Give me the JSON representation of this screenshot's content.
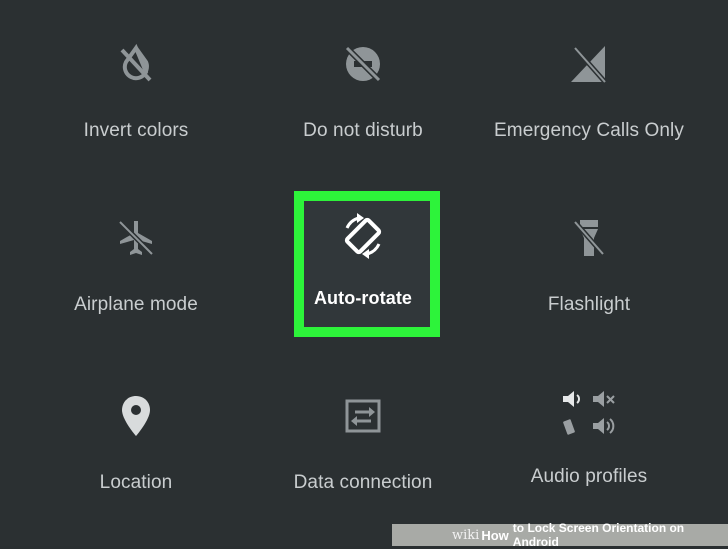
{
  "tiles": [
    {
      "label": "Invert colors",
      "icon": "invert-colors-off-icon"
    },
    {
      "label": "Do not disturb",
      "icon": "do-not-disturb-off-icon"
    },
    {
      "label": "Emergency Calls Only",
      "icon": "no-signal-icon"
    },
    {
      "label": "Airplane mode",
      "icon": "airplane-icon"
    },
    {
      "label": "Auto-rotate",
      "icon": "auto-rotate-icon"
    },
    {
      "label": "Flashlight",
      "icon": "flashlight-icon"
    },
    {
      "label": "Location",
      "icon": "location-pin-icon"
    },
    {
      "label": "Data connection",
      "icon": "data-transfer-icon"
    },
    {
      "label": "Audio profiles",
      "icon": "audio-profiles-icon"
    }
  ],
  "highlight_color": "#2df33a",
  "watermark": {
    "wiki": "wiki",
    "how": "How",
    "rest": "to Lock Screen Orientation on Android"
  }
}
